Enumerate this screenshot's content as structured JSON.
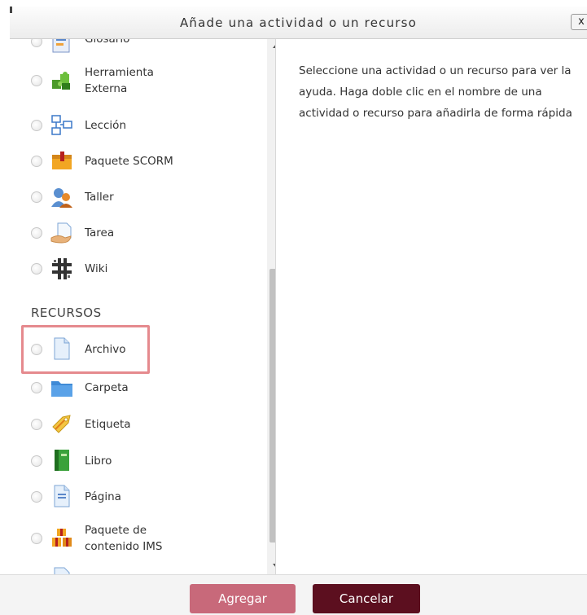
{
  "dialog": {
    "title": "Añade una actividad o un recurso",
    "close_label": "x"
  },
  "activities": [
    {
      "label": "Glosario",
      "icon": "glossary-icon"
    },
    {
      "label_line1": "Herramienta",
      "label_line2": "Externa",
      "icon": "external-tool-icon"
    },
    {
      "label": "Lección",
      "icon": "lesson-icon"
    },
    {
      "label": "Paquete SCORM",
      "icon": "scorm-package-icon"
    },
    {
      "label": "Taller",
      "icon": "workshop-icon"
    },
    {
      "label": "Tarea",
      "icon": "assignment-icon"
    },
    {
      "label": "Wiki",
      "icon": "wiki-icon"
    }
  ],
  "resources_heading": "RECURSOS",
  "resources": [
    {
      "label": "Archivo",
      "icon": "file-icon"
    },
    {
      "label": "Carpeta",
      "icon": "folder-icon"
    },
    {
      "label": "Etiqueta",
      "icon": "label-tag-icon"
    },
    {
      "label": "Libro",
      "icon": "book-icon"
    },
    {
      "label": "Página",
      "icon": "page-icon"
    },
    {
      "label_line1": "Paquete de",
      "label_line2": "contenido IMS",
      "icon": "ims-package-icon"
    }
  ],
  "help": {
    "text": "Seleccione una actividad o un recurso para ver la ayuda. Haga doble clic en el nombre de una actividad o recurso para añadirla de forma rápida"
  },
  "footer": {
    "add_label": "Agregar",
    "cancel_label": "Cancelar"
  },
  "colors": {
    "highlight": "#e58a8e",
    "add_button": "#c8697a",
    "cancel_button": "#5c0f1f"
  }
}
